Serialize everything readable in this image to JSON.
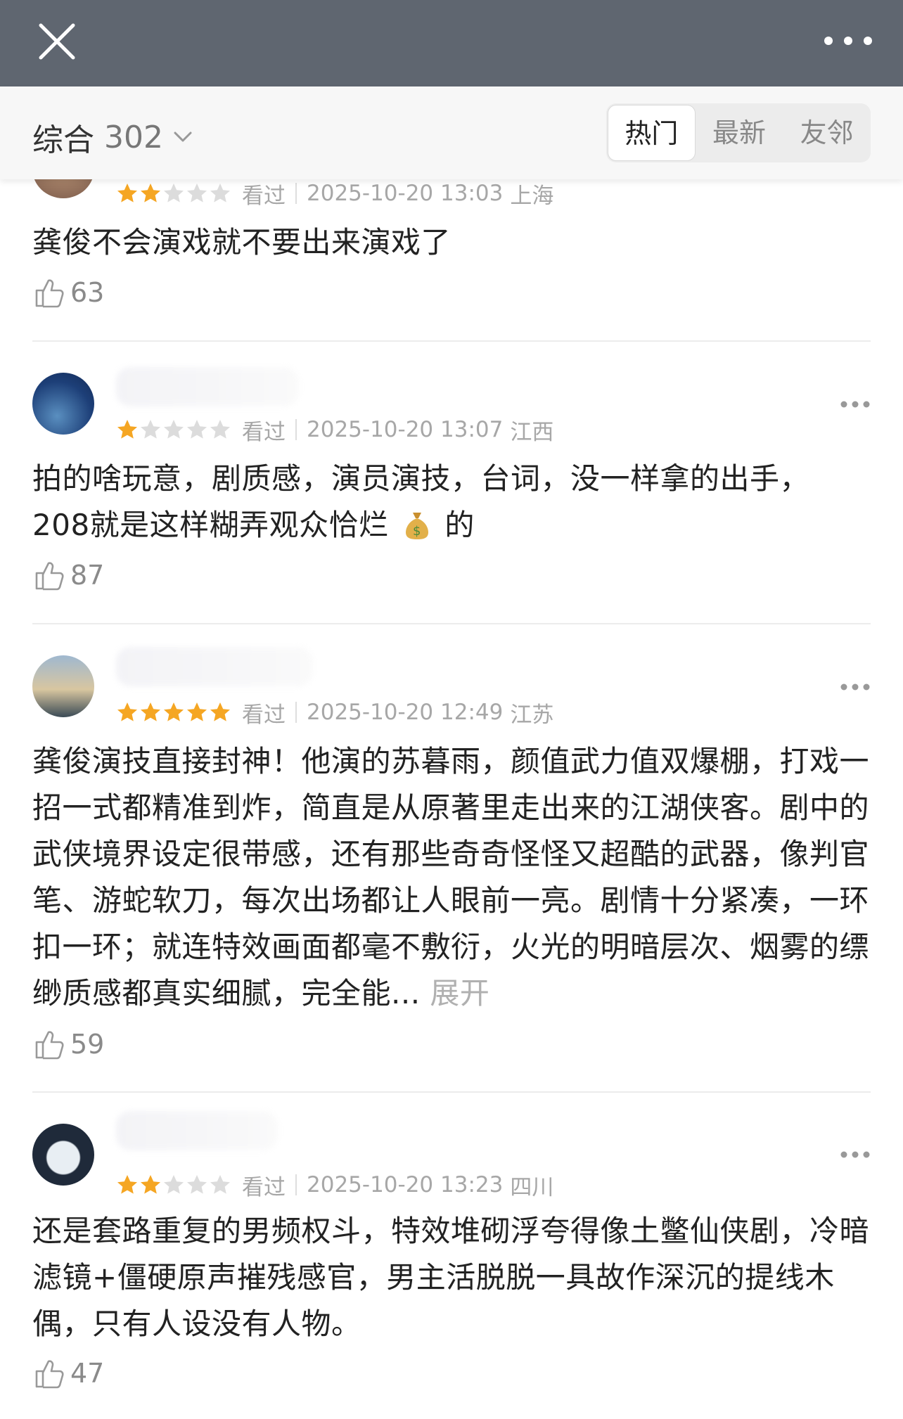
{
  "header": {
    "close_icon": "close-icon",
    "more_icon": "more-horizontal-icon",
    "background": "#5f6670"
  },
  "filter": {
    "label": "综合",
    "count": "302",
    "tabs": [
      {
        "label": "热门",
        "active": true
      },
      {
        "label": "最新",
        "active": false
      },
      {
        "label": "友邻",
        "active": false
      }
    ]
  },
  "reviews": [
    {
      "rating": 2,
      "status": "看过",
      "datetime": "2025-10-20 13:03",
      "location": "上海",
      "text": "龚俊不会演戏就不要出来演戏了",
      "likes": "63"
    },
    {
      "rating": 1,
      "status": "看过",
      "datetime": "2025-10-20 13:07",
      "location": "江西",
      "text_line1": "拍的啥玩意，剧质感，演员演技，台词，没一样拿的出手，",
      "text_line2_before": "208就是这样糊弄观众恰烂",
      "text_line2_after": "的",
      "emoji_icon": "money-bag-icon",
      "likes": "87"
    },
    {
      "rating": 5,
      "status": "看过",
      "datetime": "2025-10-20 12:49",
      "location": "江苏",
      "text": "龚俊演技直接封神！他演的苏暮雨，颜值武力值双爆棚，打戏一招一式都精准到炸，简直是从原著里走出来的江湖侠客。剧中的武侠境界设定很带感，还有那些奇奇怪怪又超酷的武器，像判官笔、游蛇软刀，每次出场都让人眼前一亮。剧情十分紧凑，一环扣一环；就连特效画面都毫不敷衍，火光的明暗层次、烟雾的缥缈质感都真实细腻，完全能...",
      "expand": "展开",
      "likes": "59"
    },
    {
      "rating": 2,
      "status": "看过",
      "datetime": "2025-10-20 13:23",
      "location": "四川",
      "text": "还是套路重复的男频权斗，特效堆砌浮夸得像土鳖仙侠剧，冷暗滤镜+僵硬原声摧残感官，男主活脱脱一具故作深沉的提线木偶，只有人设没有人物。",
      "likes": "47"
    }
  ],
  "colors": {
    "star_filled": "#f5a623",
    "star_empty": "#dcdcdc",
    "meta_text": "#a7a7a7"
  }
}
